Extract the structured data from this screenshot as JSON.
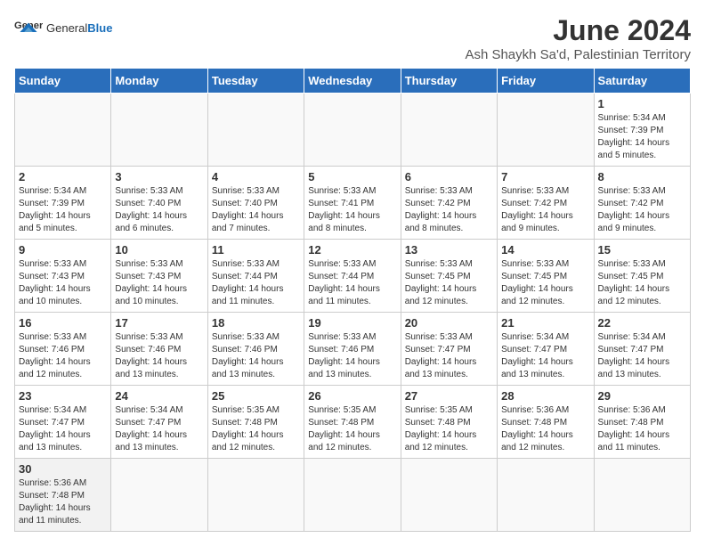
{
  "header": {
    "logo_general": "General",
    "logo_blue": "Blue",
    "month": "June 2024",
    "location": "Ash Shaykh Sa'd, Palestinian Territory"
  },
  "days_of_week": [
    "Sunday",
    "Monday",
    "Tuesday",
    "Wednesday",
    "Thursday",
    "Friday",
    "Saturday"
  ],
  "weeks": [
    [
      {
        "day": "",
        "info": ""
      },
      {
        "day": "",
        "info": ""
      },
      {
        "day": "",
        "info": ""
      },
      {
        "day": "",
        "info": ""
      },
      {
        "day": "",
        "info": ""
      },
      {
        "day": "",
        "info": ""
      },
      {
        "day": "1",
        "info": "Sunrise: 5:34 AM\nSunset: 7:39 PM\nDaylight: 14 hours\nand 5 minutes."
      }
    ],
    [
      {
        "day": "2",
        "info": "Sunrise: 5:34 AM\nSunset: 7:39 PM\nDaylight: 14 hours\nand 5 minutes."
      },
      {
        "day": "3",
        "info": "Sunrise: 5:33 AM\nSunset: 7:40 PM\nDaylight: 14 hours\nand 6 minutes."
      },
      {
        "day": "4",
        "info": "Sunrise: 5:33 AM\nSunset: 7:40 PM\nDaylight: 14 hours\nand 7 minutes."
      },
      {
        "day": "5",
        "info": "Sunrise: 5:33 AM\nSunset: 7:41 PM\nDaylight: 14 hours\nand 8 minutes."
      },
      {
        "day": "6",
        "info": "Sunrise: 5:33 AM\nSunset: 7:42 PM\nDaylight: 14 hours\nand 8 minutes."
      },
      {
        "day": "7",
        "info": "Sunrise: 5:33 AM\nSunset: 7:42 PM\nDaylight: 14 hours\nand 9 minutes."
      },
      {
        "day": "8",
        "info": "Sunrise: 5:33 AM\nSunset: 7:42 PM\nDaylight: 14 hours\nand 9 minutes."
      }
    ],
    [
      {
        "day": "9",
        "info": "Sunrise: 5:33 AM\nSunset: 7:43 PM\nDaylight: 14 hours\nand 10 minutes."
      },
      {
        "day": "10",
        "info": "Sunrise: 5:33 AM\nSunset: 7:43 PM\nDaylight: 14 hours\nand 10 minutes."
      },
      {
        "day": "11",
        "info": "Sunrise: 5:33 AM\nSunset: 7:44 PM\nDaylight: 14 hours\nand 11 minutes."
      },
      {
        "day": "12",
        "info": "Sunrise: 5:33 AM\nSunset: 7:44 PM\nDaylight: 14 hours\nand 11 minutes."
      },
      {
        "day": "13",
        "info": "Sunrise: 5:33 AM\nSunset: 7:45 PM\nDaylight: 14 hours\nand 12 minutes."
      },
      {
        "day": "14",
        "info": "Sunrise: 5:33 AM\nSunset: 7:45 PM\nDaylight: 14 hours\nand 12 minutes."
      },
      {
        "day": "15",
        "info": "Sunrise: 5:33 AM\nSunset: 7:45 PM\nDaylight: 14 hours\nand 12 minutes."
      }
    ],
    [
      {
        "day": "16",
        "info": "Sunrise: 5:33 AM\nSunset: 7:46 PM\nDaylight: 14 hours\nand 12 minutes."
      },
      {
        "day": "17",
        "info": "Sunrise: 5:33 AM\nSunset: 7:46 PM\nDaylight: 14 hours\nand 13 minutes."
      },
      {
        "day": "18",
        "info": "Sunrise: 5:33 AM\nSunset: 7:46 PM\nDaylight: 14 hours\nand 13 minutes."
      },
      {
        "day": "19",
        "info": "Sunrise: 5:33 AM\nSunset: 7:46 PM\nDaylight: 14 hours\nand 13 minutes."
      },
      {
        "day": "20",
        "info": "Sunrise: 5:33 AM\nSunset: 7:47 PM\nDaylight: 14 hours\nand 13 minutes."
      },
      {
        "day": "21",
        "info": "Sunrise: 5:34 AM\nSunset: 7:47 PM\nDaylight: 14 hours\nand 13 minutes."
      },
      {
        "day": "22",
        "info": "Sunrise: 5:34 AM\nSunset: 7:47 PM\nDaylight: 14 hours\nand 13 minutes."
      }
    ],
    [
      {
        "day": "23",
        "info": "Sunrise: 5:34 AM\nSunset: 7:47 PM\nDaylight: 14 hours\nand 13 minutes."
      },
      {
        "day": "24",
        "info": "Sunrise: 5:34 AM\nSunset: 7:47 PM\nDaylight: 14 hours\nand 13 minutes."
      },
      {
        "day": "25",
        "info": "Sunrise: 5:35 AM\nSunset: 7:48 PM\nDaylight: 14 hours\nand 12 minutes."
      },
      {
        "day": "26",
        "info": "Sunrise: 5:35 AM\nSunset: 7:48 PM\nDaylight: 14 hours\nand 12 minutes."
      },
      {
        "day": "27",
        "info": "Sunrise: 5:35 AM\nSunset: 7:48 PM\nDaylight: 14 hours\nand 12 minutes."
      },
      {
        "day": "28",
        "info": "Sunrise: 5:36 AM\nSunset: 7:48 PM\nDaylight: 14 hours\nand 12 minutes."
      },
      {
        "day": "29",
        "info": "Sunrise: 5:36 AM\nSunset: 7:48 PM\nDaylight: 14 hours\nand 11 minutes."
      }
    ],
    [
      {
        "day": "30",
        "info": "Sunrise: 5:36 AM\nSunset: 7:48 PM\nDaylight: 14 hours\nand 11 minutes."
      },
      {
        "day": "",
        "info": ""
      },
      {
        "day": "",
        "info": ""
      },
      {
        "day": "",
        "info": ""
      },
      {
        "day": "",
        "info": ""
      },
      {
        "day": "",
        "info": ""
      },
      {
        "day": "",
        "info": ""
      }
    ]
  ]
}
